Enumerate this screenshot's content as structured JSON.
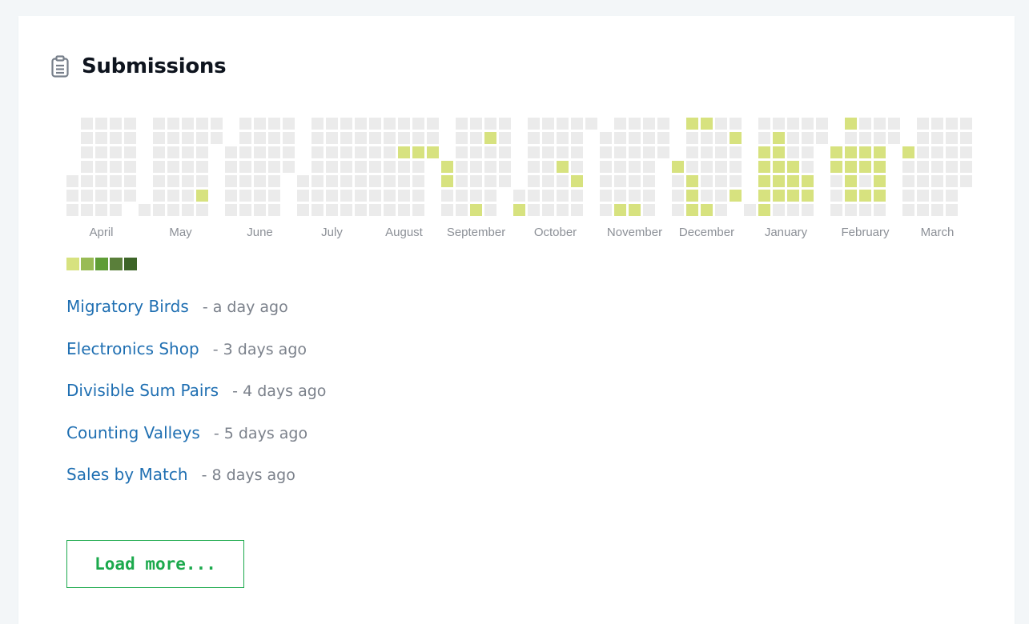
{
  "header": {
    "title": "Submissions",
    "icon": "clipboard-icon"
  },
  "heatmap": {
    "months": [
      "April",
      "May",
      "June",
      "July",
      "August",
      "September",
      "October",
      "November",
      "December",
      "January",
      "February",
      "March"
    ],
    "colors": {
      "empty": "#ebebeb",
      "levels": [
        "#d7e27f",
        "#99bb55",
        "#5f9d36",
        "#5a7f3a",
        "#3d6427"
      ]
    },
    "active_days": [
      "May 28",
      "Aug 17",
      "Aug 24",
      "Aug 31",
      "Sep 1",
      "Sep 2",
      "Sep 18",
      "Sep 20",
      "Oct 2",
      "Oct 20",
      "Oct 28",
      "Nov 13",
      "Nov 20",
      "Dec 1",
      "Dec 5",
      "Dec 9",
      "Dec 10",
      "Dec 11",
      "Dec 12",
      "Dec 18",
      "Dec 27",
      "Dec 31",
      "Jan 4",
      "Jan 5",
      "Jan 6",
      "Jan 7",
      "Jan 8",
      "Jan 10",
      "Jan 11",
      "Jan 12",
      "Jan 13",
      "Jan 14",
      "Jan 19",
      "Jan 20",
      "Jan 21",
      "Jan 27",
      "Jan 28",
      "Feb 1",
      "Feb 2",
      "Feb 6",
      "Feb 8",
      "Feb 9",
      "Feb 10",
      "Feb 11",
      "Feb 15",
      "Feb 16",
      "Feb 18",
      "Feb 22",
      "Feb 23",
      "Feb 24",
      "Feb 25",
      "Mar 1"
    ]
  },
  "legend": {
    "colors": [
      "#d7e27f",
      "#99bb55",
      "#5f9d36",
      "#5a7f3a",
      "#3d6427"
    ]
  },
  "submissions": [
    {
      "name": "Migratory Birds",
      "time": "- a day ago"
    },
    {
      "name": "Electronics Shop",
      "time": "- 3 days ago"
    },
    {
      "name": "Divisible Sum Pairs",
      "time": "- 4 days ago"
    },
    {
      "name": "Counting Valleys",
      "time": "- 5 days ago"
    },
    {
      "name": "Sales by Match",
      "time": "- 8 days ago"
    }
  ],
  "load_more_label": "Load more..."
}
